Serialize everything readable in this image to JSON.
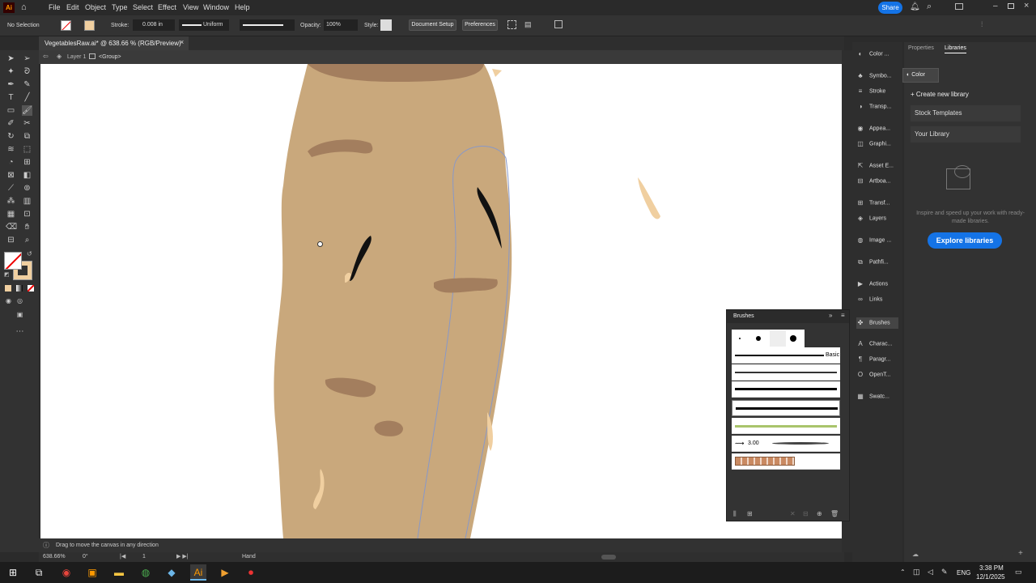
{
  "menubar": {
    "app_icon": "Ai",
    "items": [
      "File",
      "Edit",
      "Object",
      "Type",
      "Select",
      "Effect",
      "View",
      "Window",
      "Help"
    ],
    "share_label": "Share"
  },
  "control": {
    "selection": "No Selection",
    "stroke_label": "Stroke:",
    "stroke_value": "0.008 in",
    "profile": "Uniform",
    "opacity_label": "Opacity:",
    "opacity_value": "100%",
    "style_label": "Style:",
    "document_setup": "Document Setup",
    "preferences": "Preferences"
  },
  "document": {
    "tab_title": "VegetablesRaw.ai* @ 638.66 % (RGB/Preview)",
    "close_icon": "close-icon",
    "breadcrumb_layer": "Layer 1",
    "breadcrumb_group": "<Group>"
  },
  "status": {
    "hint": "Drag to move the canvas in any direction",
    "zoom": "638.66%",
    "rotation": "0°",
    "artboard": "1",
    "tool": "Hand"
  },
  "dock": {
    "items": [
      "Color ...",
      "Symbo...",
      "Stroke",
      "Transp...",
      "Appea...",
      "Graphi...",
      "Asset E...",
      "Artboa...",
      "Transf...",
      "Layers",
      "Image ...",
      "Pathfi...",
      "Actions",
      "Links",
      "Brushes",
      "Charac...",
      "Paragr...",
      "OpenT...",
      "Swatc..."
    ]
  },
  "right_panel": {
    "tabs": [
      "Properties",
      "Libraries"
    ],
    "color_popup": "Color",
    "create_library": "Create new library",
    "stock_templates": "Stock Templates",
    "your_library": "Your Library",
    "promo_text": "Inspire and speed up your work with ready-made libraries.",
    "explore_button": "Explore libraries"
  },
  "brushes": {
    "title": "Brushes",
    "basic_label": "Basic",
    "size_value": "3.00"
  },
  "taskbar": {
    "lang": "ENG",
    "time": "3:38 PM",
    "date": "12/1/2025"
  },
  "colors": {
    "potato": "#c9a87c",
    "potato_dark": "#a37e5e",
    "sprout": "#f0cfa0",
    "accent_blue": "#1473e6",
    "ai_orange": "#ff9a00",
    "ai_bg": "#330000"
  }
}
